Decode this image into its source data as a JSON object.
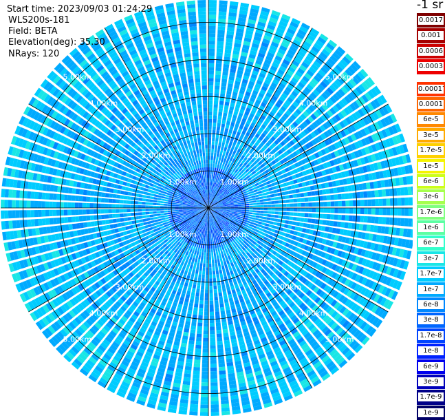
{
  "header": {
    "start_time": "Start time: 2023/09/03 01:24:29",
    "instrument": "WLS200s-181",
    "field": "Field: BETA",
    "elevation": "Elevation(deg): 35.30",
    "nrays": "NRays: 120"
  },
  "unit_label": "-1 sr",
  "chart_data": {
    "type": "heatmap",
    "projection": "polar-ppi",
    "field": "BETA",
    "elevation_deg": 35.3,
    "n_rays": 120,
    "range_rings_km": [
      1,
      2,
      3,
      4,
      5
    ],
    "range_ring_labels": [
      "1.00km",
      "2.00km",
      "3.00km",
      "4.00km",
      "5.00km"
    ],
    "azimuth_spokes_deg": [
      0,
      30,
      60,
      90,
      120,
      150,
      180,
      210,
      240,
      270,
      300,
      330
    ],
    "max_range_km": 5.6,
    "dominant_level_near_range": "1e-8",
    "dominant_level_far_range": "1.7e-8",
    "colorbar": {
      "upper": [
        "0.0017",
        "0.001",
        "0.0006",
        "0.0003"
      ],
      "lower": [
        "0.00017",
        "0.0001",
        "6e-5",
        "3e-5",
        "1.7e-5",
        "1e-5",
        "6e-6",
        "3e-6",
        "1.7e-6",
        "1e-6",
        "6e-7",
        "3e-7",
        "1.7e-7",
        "1e-7",
        "6e-8",
        "3e-8",
        "1.7e-8",
        "1e-8",
        "6e-9",
        "3e-9",
        "1.7e-9",
        "1e-9"
      ],
      "upper_colors": [
        "#7f0000",
        "#a50000",
        "#cc0000",
        "#ee0000"
      ],
      "lower_colors": [
        "#ff3300",
        "#ff6600",
        "#ff8800",
        "#ffaa00",
        "#ffd000",
        "#f4f400",
        "#ccff1a",
        "#a6ff4d",
        "#80ff80",
        "#5cffa3",
        "#33ffcc",
        "#19e6e6",
        "#00ccff",
        "#00aaff",
        "#0088ff",
        "#0066ff",
        "#0044ff",
        "#0022ff",
        "#0000ee",
        "#0000bb",
        "#000088",
        "#000066"
      ]
    }
  }
}
